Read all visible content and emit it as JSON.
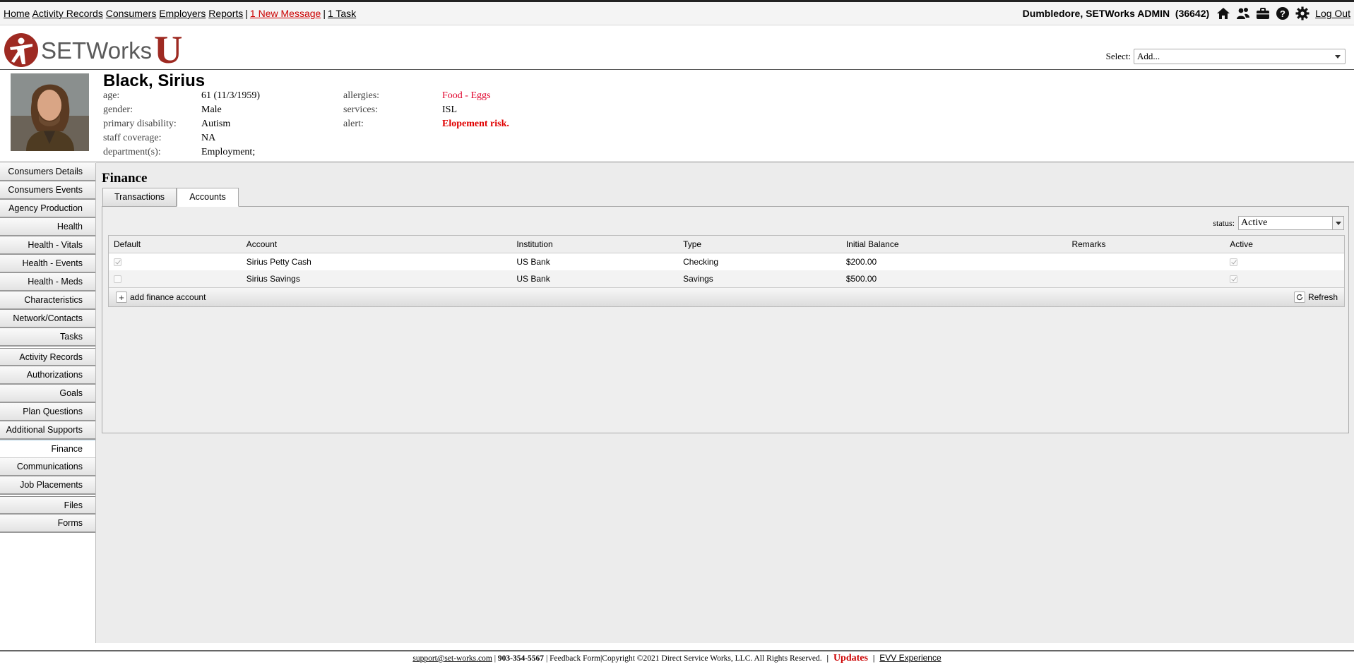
{
  "topnav": {
    "home": "Home",
    "activity_records": "Activity Records",
    "consumers": "Consumers",
    "employers": "Employers",
    "reports": "Reports",
    "separator": "|",
    "new_message": "1 New Message",
    "task": "1 Task"
  },
  "user": {
    "name": "Dumbledore, SETWorks ADMIN",
    "id": "(36642)",
    "logout": "Log Out",
    "icons": [
      "home-icon",
      "people-icon",
      "briefcase-icon",
      "help-icon",
      "gear-icon"
    ]
  },
  "logo": {
    "text": "SETWorks",
    "letter": "U",
    "accent": "#9e2a22"
  },
  "select": {
    "label": "Select:",
    "value": "Add..."
  },
  "consumer": {
    "name": "Black, Sirius",
    "fields_left": [
      {
        "label": "age:",
        "value": "61 (11/3/1959)"
      },
      {
        "label": "gender:",
        "value": "Male"
      },
      {
        "label": "primary disability:",
        "value": "Autism"
      },
      {
        "label": "staff coverage:",
        "value": "NA"
      },
      {
        "label": "department(s):",
        "value": "Employment;"
      }
    ],
    "fields_right": [
      {
        "label": "allergies:",
        "value": "Food - Eggs"
      },
      {
        "label": "services:",
        "value": "ISL"
      },
      {
        "label": "alert:",
        "value": "Elopement risk."
      }
    ]
  },
  "sidebar": {
    "items": [
      "Consumers Details",
      "Consumers Events",
      "Agency Production",
      "Health",
      "Health - Vitals",
      "Health - Events",
      "Health - Meds",
      "Characteristics",
      "Network/Contacts",
      "Tasks",
      "Activity Records",
      "Authorizations",
      "Goals",
      "Plan Questions",
      "Additional Supports",
      "Finance",
      "Communications",
      "Job Placements",
      "Files",
      "Forms"
    ],
    "active": "Finance"
  },
  "main": {
    "title": "Finance",
    "tabs": [
      "Transactions",
      "Accounts"
    ],
    "active_tab": "Accounts",
    "status_label": "status:",
    "status_value": "Active"
  },
  "grid": {
    "columns": [
      "Default",
      "Account",
      "Institution",
      "Type",
      "Initial Balance",
      "Remarks",
      "Active"
    ],
    "rows": [
      {
        "default": true,
        "account": "Sirius Petty Cash",
        "institution": "US Bank",
        "type": "Checking",
        "balance": "$200.00",
        "remarks": "",
        "active": true
      },
      {
        "default": false,
        "account": "Sirius Savings",
        "institution": "US Bank",
        "type": "Savings",
        "balance": "$500.00",
        "remarks": "",
        "active": true
      }
    ],
    "add_label": "add finance account",
    "refresh_label": "Refresh"
  },
  "footer": {
    "email": "support@set-works.com",
    "sep1": "|",
    "phone": "903-354-5567",
    "sep2": "|",
    "feedback": "Feedback Form|Copyright ©2021 Direct Service Works, LLC. All Rights Reserved.",
    "updates": "Updates",
    "evv": "EVV Experience"
  }
}
